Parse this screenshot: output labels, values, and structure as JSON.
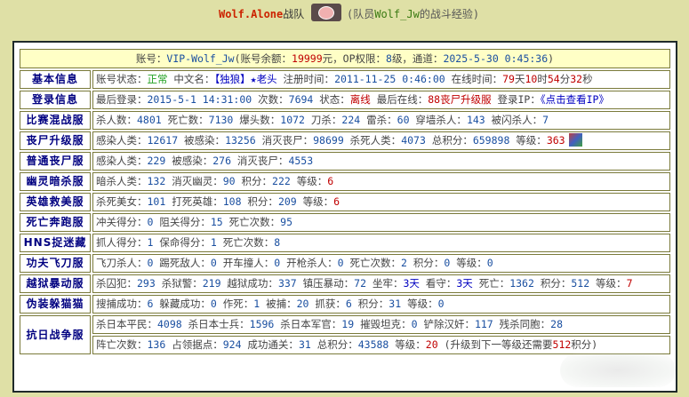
{
  "header": {
    "team_name": "Wolf.Alone",
    "team_suffix": "战队",
    "member_prefix": "(队员",
    "member_name": "Wolf_Jw",
    "member_suffix": "的战斗经验)"
  },
  "account": {
    "label": "账号：",
    "id": "VIP-Wolf_Jw",
    "balance_label": "(账号余额：",
    "balance": "19999",
    "balance_unit": "元，OP权限：",
    "op_level": "8",
    "op_unit": "级，通道：",
    "channel_time": "2025-5-30 0:45:36",
    "close": ")"
  },
  "rows": [
    {
      "label": "基本信息",
      "lines": [
        [
          {
            "t": "账号状态：",
            "c": "k"
          },
          {
            "t": "正常",
            "c": "g"
          },
          {
            "t": " 中文名：",
            "c": "k"
          },
          {
            "t": "【独狼】★老头",
            "c": "blue"
          },
          {
            "t": " 注册时间：",
            "c": "k"
          },
          {
            "t": "2011-11-25 0:46:00",
            "c": "n"
          },
          {
            "t": " 在线时间：",
            "c": "k"
          },
          {
            "t": "79",
            "c": "r"
          },
          {
            "t": "天",
            "c": "k"
          },
          {
            "t": "10",
            "c": "r"
          },
          {
            "t": "时",
            "c": "k"
          },
          {
            "t": "54",
            "c": "r"
          },
          {
            "t": "分",
            "c": "k"
          },
          {
            "t": "32",
            "c": "r"
          },
          {
            "t": "秒",
            "c": "k"
          }
        ]
      ]
    },
    {
      "label": "登录信息",
      "lines": [
        [
          {
            "t": "最后登录：",
            "c": "k"
          },
          {
            "t": "2015-5-1 14:31:00",
            "c": "n"
          },
          {
            "t": " 次数：",
            "c": "k"
          },
          {
            "t": "7694",
            "c": "n"
          },
          {
            "t": " 状态：",
            "c": "k"
          },
          {
            "t": "离线",
            "c": "r"
          },
          {
            "t": " 最后在线：",
            "c": "k"
          },
          {
            "t": "88丧尸升级服",
            "c": "r"
          },
          {
            "t": " 登录IP：",
            "c": "k"
          },
          {
            "t": "《点击查看IP》",
            "c": "blue"
          }
        ]
      ]
    },
    {
      "label": "比赛混战服",
      "lines": [
        [
          {
            "t": "杀人数：",
            "c": "k"
          },
          {
            "t": "4801",
            "c": "n"
          },
          {
            "t": " 死亡数：",
            "c": "k"
          },
          {
            "t": "7130",
            "c": "n"
          },
          {
            "t": " 爆头数：",
            "c": "k"
          },
          {
            "t": "1072",
            "c": "n"
          },
          {
            "t": " 刀杀：",
            "c": "k"
          },
          {
            "t": "224",
            "c": "n"
          },
          {
            "t": " 雷杀：",
            "c": "k"
          },
          {
            "t": "60",
            "c": "n"
          },
          {
            "t": " 穿墙杀人：",
            "c": "k"
          },
          {
            "t": "143",
            "c": "n"
          },
          {
            "t": " 被闪杀人：",
            "c": "k"
          },
          {
            "t": "7",
            "c": "n"
          }
        ]
      ]
    },
    {
      "label": "丧尸升级服",
      "avatar": true,
      "lines": [
        [
          {
            "t": "感染人类：",
            "c": "k"
          },
          {
            "t": "12617",
            "c": "n"
          },
          {
            "t": " 被感染：",
            "c": "k"
          },
          {
            "t": "13256",
            "c": "n"
          },
          {
            "t": " 消灭丧尸：",
            "c": "k"
          },
          {
            "t": "98699",
            "c": "n"
          },
          {
            "t": " 杀死人类：",
            "c": "k"
          },
          {
            "t": "4073",
            "c": "n"
          },
          {
            "t": " 总积分：",
            "c": "k"
          },
          {
            "t": "659898",
            "c": "n"
          },
          {
            "t": " 等级：",
            "c": "k"
          },
          {
            "t": "363",
            "c": "r"
          }
        ]
      ]
    },
    {
      "label": "普通丧尸服",
      "lines": [
        [
          {
            "t": "感染人类：",
            "c": "k"
          },
          {
            "t": "229",
            "c": "n"
          },
          {
            "t": " 被感染：",
            "c": "k"
          },
          {
            "t": "276",
            "c": "n"
          },
          {
            "t": " 消灭丧尸：",
            "c": "k"
          },
          {
            "t": "4553",
            "c": "n"
          }
        ]
      ]
    },
    {
      "label": "幽灵暗杀服",
      "lines": [
        [
          {
            "t": "暗杀人类：",
            "c": "k"
          },
          {
            "t": "132",
            "c": "n"
          },
          {
            "t": " 消灭幽灵：",
            "c": "k"
          },
          {
            "t": "90",
            "c": "n"
          },
          {
            "t": " 积分：",
            "c": "k"
          },
          {
            "t": "222",
            "c": "n"
          },
          {
            "t": " 等级：",
            "c": "k"
          },
          {
            "t": "6",
            "c": "r"
          }
        ]
      ]
    },
    {
      "label": "英雄救美服",
      "lines": [
        [
          {
            "t": "杀死美女：",
            "c": "k"
          },
          {
            "t": "101",
            "c": "n"
          },
          {
            "t": " 打死英雄：",
            "c": "k"
          },
          {
            "t": "108",
            "c": "n"
          },
          {
            "t": " 积分：",
            "c": "k"
          },
          {
            "t": "209",
            "c": "n"
          },
          {
            "t": " 等级：",
            "c": "k"
          },
          {
            "t": "6",
            "c": "r"
          }
        ]
      ]
    },
    {
      "label": "死亡奔跑服",
      "lines": [
        [
          {
            "t": "冲关得分：",
            "c": "k"
          },
          {
            "t": "0",
            "c": "n"
          },
          {
            "t": " 阻关得分：",
            "c": "k"
          },
          {
            "t": "15",
            "c": "n"
          },
          {
            "t": " 死亡次数：",
            "c": "k"
          },
          {
            "t": "95",
            "c": "n"
          }
        ]
      ]
    },
    {
      "label": "HNS捉迷藏",
      "lines": [
        [
          {
            "t": "抓人得分：",
            "c": "k"
          },
          {
            "t": "1",
            "c": "n"
          },
          {
            "t": " 保命得分：",
            "c": "k"
          },
          {
            "t": "1",
            "c": "n"
          },
          {
            "t": " 死亡次数：",
            "c": "k"
          },
          {
            "t": "8",
            "c": "n"
          }
        ]
      ]
    },
    {
      "label": "功夫飞刀服",
      "lines": [
        [
          {
            "t": "飞刀杀人：",
            "c": "k"
          },
          {
            "t": "0",
            "c": "n"
          },
          {
            "t": " 踢死敌人：",
            "c": "k"
          },
          {
            "t": "0",
            "c": "n"
          },
          {
            "t": " 开车撞人：",
            "c": "k"
          },
          {
            "t": "0",
            "c": "n"
          },
          {
            "t": " 开枪杀人：",
            "c": "k"
          },
          {
            "t": "0",
            "c": "n"
          },
          {
            "t": " 死亡次数：",
            "c": "k"
          },
          {
            "t": "2",
            "c": "n"
          },
          {
            "t": " 积分：",
            "c": "k"
          },
          {
            "t": "0",
            "c": "n"
          },
          {
            "t": " 等级：",
            "c": "k"
          },
          {
            "t": "0",
            "c": "n"
          }
        ]
      ]
    },
    {
      "label": "越狱暴动服",
      "lines": [
        [
          {
            "t": "杀囚犯：",
            "c": "k"
          },
          {
            "t": "293",
            "c": "n"
          },
          {
            "t": " 杀狱警：",
            "c": "k"
          },
          {
            "t": "219",
            "c": "n"
          },
          {
            "t": " 越狱成功：",
            "c": "k"
          },
          {
            "t": "337",
            "c": "n"
          },
          {
            "t": " 镇压暴动：",
            "c": "k"
          },
          {
            "t": "72",
            "c": "n"
          },
          {
            "t": " 坐牢：",
            "c": "k"
          },
          {
            "t": "3天",
            "c": "blue"
          },
          {
            "t": " 看守：",
            "c": "k"
          },
          {
            "t": "3天",
            "c": "blue"
          },
          {
            "t": " 死亡：",
            "c": "k"
          },
          {
            "t": "1362",
            "c": "n"
          },
          {
            "t": " 积分：",
            "c": "k"
          },
          {
            "t": "512",
            "c": "n"
          },
          {
            "t": " 等级：",
            "c": "k"
          },
          {
            "t": "7",
            "c": "r"
          }
        ]
      ]
    },
    {
      "label": "伪装躲猫猫",
      "lines": [
        [
          {
            "t": "搜捕成功：",
            "c": "k"
          },
          {
            "t": "6",
            "c": "n"
          },
          {
            "t": " 躲藏成功：",
            "c": "k"
          },
          {
            "t": "0",
            "c": "n"
          },
          {
            "t": " 作死：",
            "c": "k"
          },
          {
            "t": "1",
            "c": "n"
          },
          {
            "t": " 被捕：",
            "c": "k"
          },
          {
            "t": "20",
            "c": "n"
          },
          {
            "t": " 抓获：",
            "c": "k"
          },
          {
            "t": "6",
            "c": "n"
          },
          {
            "t": " 积分：",
            "c": "k"
          },
          {
            "t": "31",
            "c": "n"
          },
          {
            "t": " 等级：",
            "c": "k"
          },
          {
            "t": "0",
            "c": "n"
          }
        ]
      ]
    },
    {
      "label": "抗日战争服",
      "lines": [
        [
          {
            "t": "杀日本平民：",
            "c": "k"
          },
          {
            "t": "4098",
            "c": "n"
          },
          {
            "t": " 杀日本士兵：",
            "c": "k"
          },
          {
            "t": "1596",
            "c": "n"
          },
          {
            "t": " 杀日本军官：",
            "c": "k"
          },
          {
            "t": "19",
            "c": "n"
          },
          {
            "t": " 摧毁坦克：",
            "c": "k"
          },
          {
            "t": "0",
            "c": "n"
          },
          {
            "t": " 铲除汉奸：",
            "c": "k"
          },
          {
            "t": "117",
            "c": "n"
          },
          {
            "t": " 残杀同胞：",
            "c": "k"
          },
          {
            "t": "28",
            "c": "n"
          }
        ],
        [
          {
            "t": "阵亡次数：",
            "c": "k"
          },
          {
            "t": "136",
            "c": "n"
          },
          {
            "t": " 占领据点：",
            "c": "k"
          },
          {
            "t": "924",
            "c": "n"
          },
          {
            "t": " 成功通关：",
            "c": "k"
          },
          {
            "t": "31",
            "c": "n"
          },
          {
            "t": " 总积分：",
            "c": "k"
          },
          {
            "t": "43588",
            "c": "n"
          },
          {
            "t": " 等级：",
            "c": "k"
          },
          {
            "t": "20",
            "c": "r"
          },
          {
            "t": " (升级到下一等级还需要",
            "c": "k"
          },
          {
            "t": "512",
            "c": "r"
          },
          {
            "t": "积分)",
            "c": "k"
          }
        ]
      ]
    }
  ]
}
